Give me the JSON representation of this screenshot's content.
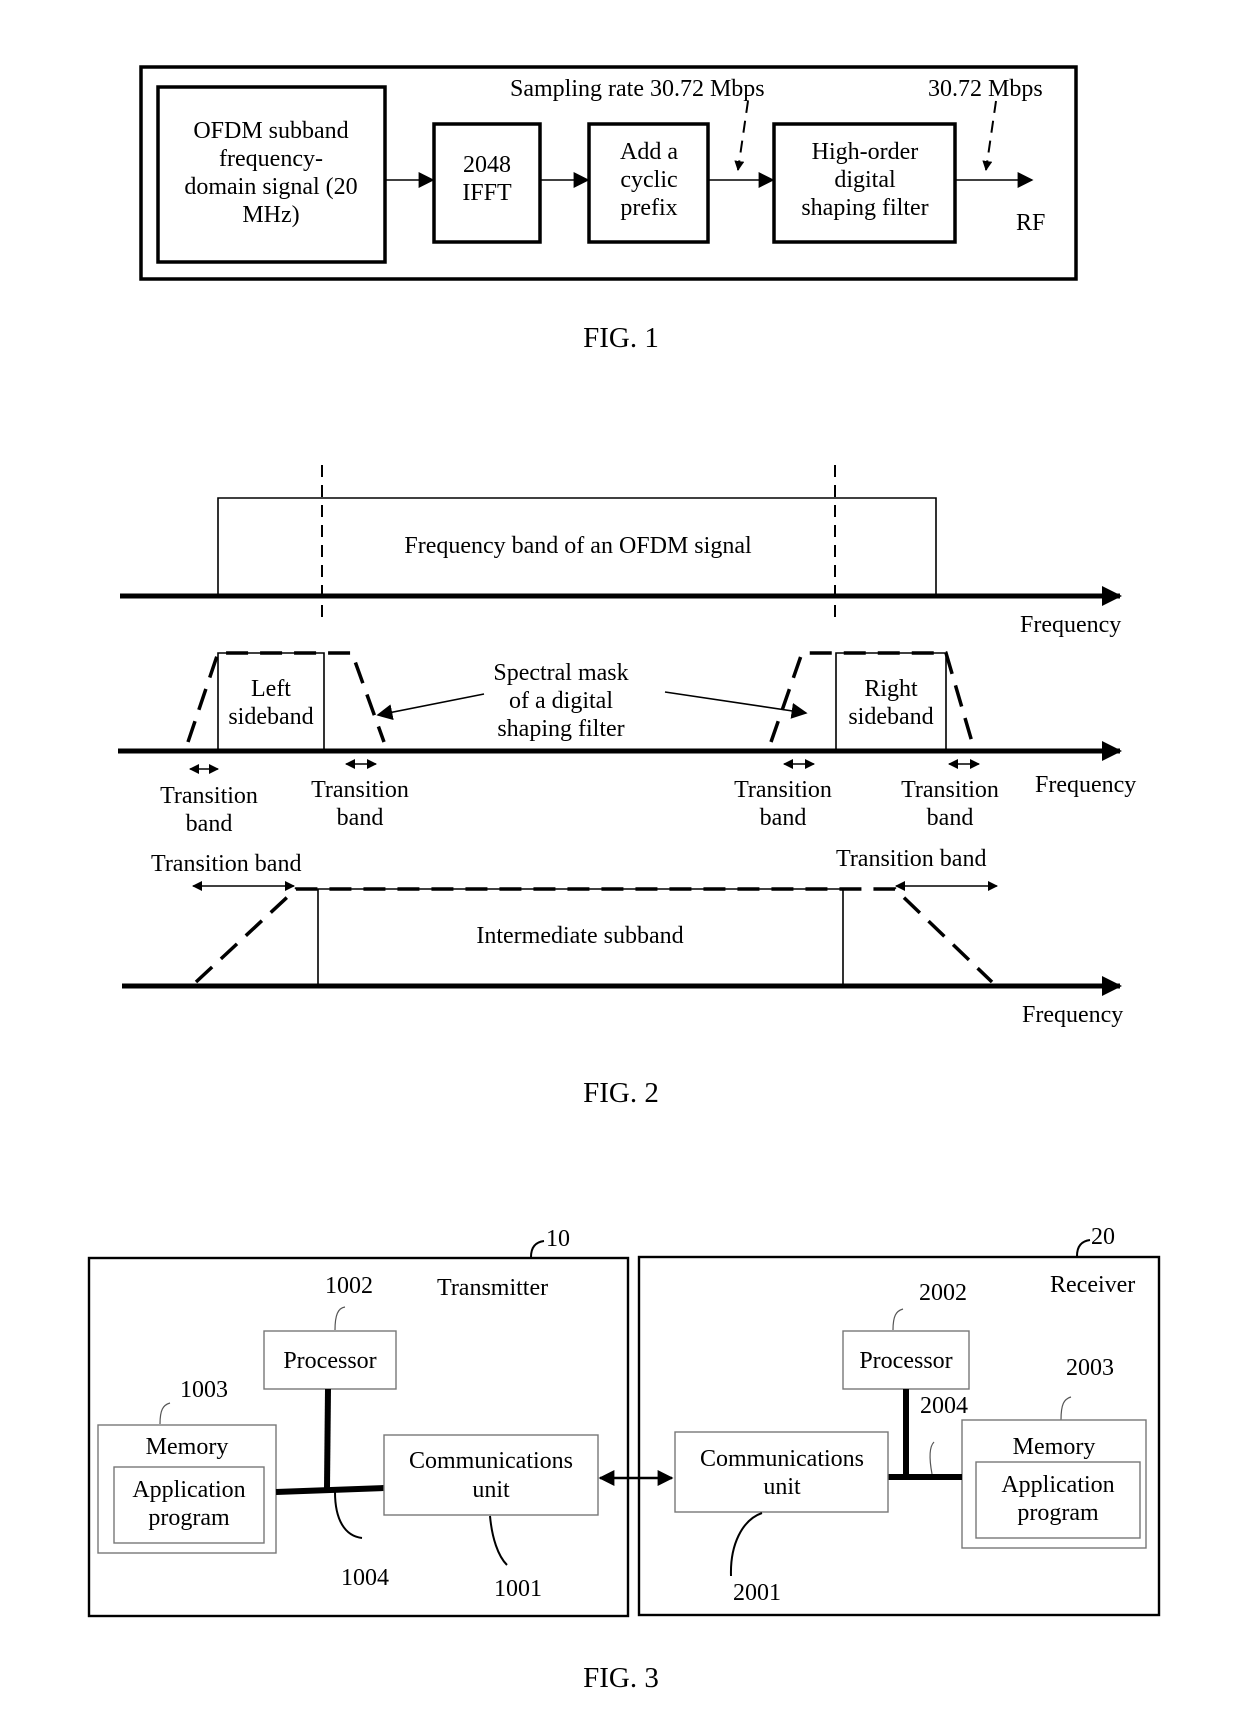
{
  "fig1": {
    "caption": "FIG. 1",
    "blocks": {
      "ofdm": [
        "OFDM subband",
        "frequency-",
        "domain signal (20",
        "MHz)"
      ],
      "ifft": [
        "2048",
        "IFFT"
      ],
      "cp": [
        "Add a",
        "cyclic",
        "prefix"
      ],
      "filter": [
        "High-order",
        "digital",
        "shaping filter"
      ]
    },
    "sampling_rate_label": "Sampling rate 30.72 Mbps",
    "output_rate_label": "30.72 Mbps",
    "output_label": "RF"
  },
  "fig2": {
    "caption": "FIG. 2",
    "row1": {
      "band_label": "Frequency band of an OFDM signal",
      "axis_label": "Frequency"
    },
    "row2": {
      "left_sideband": [
        "Left",
        "sideband"
      ],
      "right_sideband": [
        "Right",
        "sideband"
      ],
      "mask_label": [
        "Spectral mask",
        "of a digital",
        "shaping filter"
      ],
      "transition_labels": [
        [
          "Transition",
          "band"
        ],
        [
          "Transition",
          "band"
        ],
        [
          "Transition",
          "band"
        ],
        [
          "Transition",
          "band"
        ]
      ],
      "axis_label": "Frequency"
    },
    "row3": {
      "left_transition": "Transition band",
      "right_transition": "Transition band",
      "subband_label": "Intermediate subband",
      "axis_label": "Frequency"
    }
  },
  "fig3": {
    "caption": "FIG. 3",
    "transmitter": {
      "ref": "10",
      "title": "Transmitter",
      "processor": {
        "ref": "1002",
        "label": "Processor"
      },
      "memory": {
        "ref": "1003",
        "label": "Memory",
        "app": [
          "Application",
          "program"
        ]
      },
      "bus_ref": "1004",
      "comm": {
        "ref": "1001",
        "label": [
          "Communications",
          "unit"
        ]
      }
    },
    "receiver": {
      "ref": "20",
      "title": "Receiver",
      "processor": {
        "ref": "2002",
        "label": "Processor"
      },
      "memory": {
        "ref": "2003",
        "label": "Memory",
        "app": [
          "Application",
          "program"
        ]
      },
      "bus_ref": "2004",
      "comm": {
        "ref": "2001",
        "label": [
          "Communications",
          "unit"
        ]
      }
    }
  }
}
